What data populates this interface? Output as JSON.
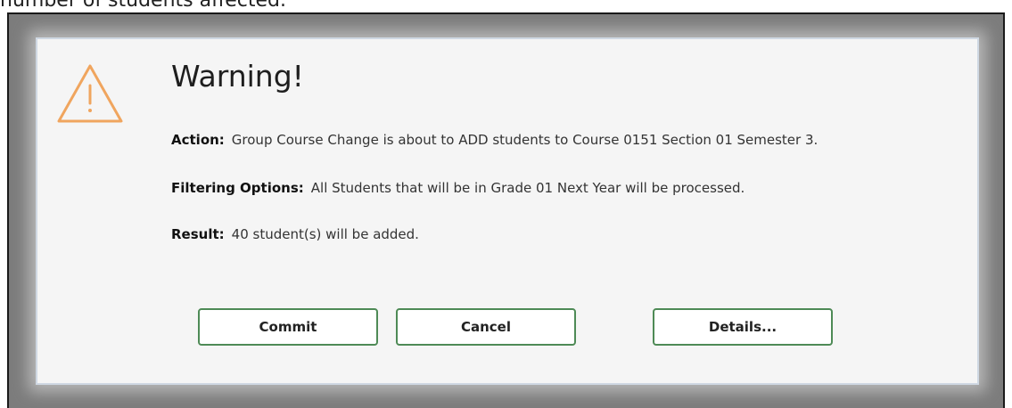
{
  "caption": "number of students affected.",
  "dialog": {
    "icon": "warning-triangle-icon",
    "title": "Warning!",
    "action": {
      "label": "Action:",
      "text": "Group Course Change is about to ADD students to Course 0151 Section 01 Semester 3."
    },
    "filtering": {
      "label": "Filtering Options:",
      "text": "All Students that will be in Grade 01 Next Year will be processed."
    },
    "result": {
      "label": "Result:",
      "text": "40 student(s) will be added."
    },
    "buttons": {
      "commit": "Commit",
      "cancel": "Cancel",
      "details": "Details..."
    }
  },
  "colors": {
    "warning": "#f0a55e",
    "button_border": "#4e8a56",
    "dialog_bg": "#f5f5f5",
    "overlay": "#7c7c7c"
  }
}
